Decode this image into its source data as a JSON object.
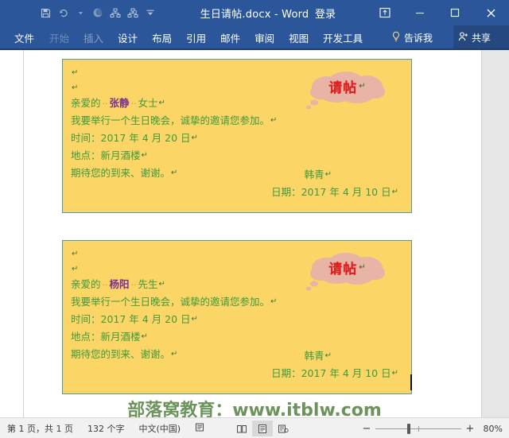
{
  "window": {
    "title": "生日请帖.docx  -  Word",
    "signin_label": "登录",
    "quick_access": [
      {
        "name": "save-icon",
        "label": "保存"
      },
      {
        "name": "undo-dropdown-icon",
        "label": "撤消"
      },
      {
        "name": "redo-icon",
        "label": "恢复"
      },
      {
        "name": "hierarchy-icon-1",
        "label": "组织结构"
      },
      {
        "name": "hierarchy-icon-2",
        "label": "组织结构"
      },
      {
        "name": "customize-qat-icon",
        "label": "自定义快速访问工具栏"
      }
    ],
    "controls": [
      {
        "name": "ribbon-display-options-button",
        "glyph": "▣"
      },
      {
        "name": "minimize-button",
        "glyph": "—"
      },
      {
        "name": "restore-button",
        "glyph": "□"
      },
      {
        "name": "close-button",
        "glyph": "✕"
      }
    ]
  },
  "ribbon": {
    "tabs": [
      {
        "label": "文件",
        "state": "file"
      },
      {
        "label": "开始",
        "state": "dim"
      },
      {
        "label": "插入",
        "state": "dim"
      },
      {
        "label": "设计",
        "state": "normal"
      },
      {
        "label": "布局",
        "state": "normal"
      },
      {
        "label": "引用",
        "state": "normal"
      },
      {
        "label": "邮件",
        "state": "normal"
      },
      {
        "label": "审阅",
        "state": "normal"
      },
      {
        "label": "视图",
        "state": "normal"
      },
      {
        "label": "开发工具",
        "state": "normal"
      }
    ],
    "tell_me": "告诉我",
    "share": "共享"
  },
  "document": {
    "cards": [
      {
        "id": "invitation-card-1",
        "stamp": "请帖",
        "greeting_prefix": "亲爱的",
        "greeting_name": "张静",
        "greeting_suffix": "女士",
        "body": "我要举行一个生日晚会，诚挚的邀请您参加。",
        "time_line": "时间：2017 年 4 月 20 日",
        "place_line": "地点：新月酒楼",
        "closing": "期待您的到来、谢谢。",
        "sign_name": "韩青",
        "sign_date": "日期：2017 年 4 月 10 日"
      },
      {
        "id": "invitation-card-2",
        "stamp": "请帖",
        "greeting_prefix": "亲爱的",
        "greeting_name": "杨阳",
        "greeting_suffix": "先生",
        "body": "我要举行一个生日晚会，诚挚的邀请您参加。",
        "time_line": "时间：2017 年 4 月 20 日",
        "place_line": "地点：新月酒楼",
        "closing": "期待您的到来、谢谢。",
        "sign_name": "韩青",
        "sign_date": "日期：2017 年 4 月 10 日"
      }
    ],
    "paragraph_mark": "↵"
  },
  "watermark": "部落窝教育：www.itblw.com",
  "status_bar": {
    "pages": "第 1 页，共 1 页",
    "words": "132 个字",
    "language": "中文(中国)",
    "views": [
      {
        "name": "read-mode-view-button",
        "label": "阅读视图"
      },
      {
        "name": "print-layout-view-button",
        "label": "页面视图"
      },
      {
        "name": "web-layout-view-button",
        "label": "Web 版式视图"
      }
    ],
    "zoom_out": "−",
    "zoom_in": "+",
    "zoom_level": "80%"
  },
  "colors": {
    "title_bar": "#2b579a",
    "card_fill": "#fbd565",
    "card_border": "#4f9e9e",
    "text_green": "#3f9a3f",
    "name_purple": "#7b2f8f",
    "stamp_red": "#e01b1b",
    "stamp_fill": "#e8b4a6",
    "watermark_green": "#5f8a4e"
  }
}
